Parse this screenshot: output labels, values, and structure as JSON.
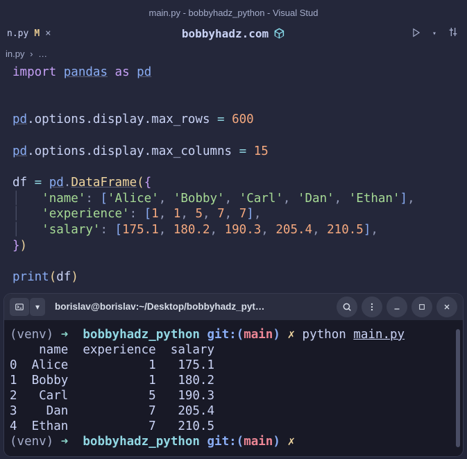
{
  "titlebar": "main.py - bobbyhadz_python - Visual Stud",
  "tab": {
    "label": "n.py",
    "modified": "M",
    "close": "×"
  },
  "center_title": "bobbyhadz.com",
  "breadcrumb": {
    "file": "in.py",
    "sep": "›",
    "more": "…"
  },
  "code": {
    "import_kw": "import",
    "pandas": "pandas",
    "as_kw": "as",
    "pd": "pd",
    "line_rows": ".options.display.max_rows ",
    "eq": "=",
    "val600": " 600",
    "line_cols": ".options.display.max_columns ",
    "val15": " 15",
    "df": "df ",
    "eq2": "= ",
    "dot": ".",
    "dataframe": "DataFrame",
    "open_p": "(",
    "open_b": "{",
    "name_key": "'name'",
    "colon": ": ",
    "names": [
      "'Alice'",
      "'Bobby'",
      "'Carl'",
      "'Dan'",
      "'Ethan'"
    ],
    "exp_key": "'experience'",
    "exps": [
      "1",
      "1",
      "5",
      "7",
      "7"
    ],
    "sal_key": "'salary'",
    "sals": [
      "175.1",
      "180.2",
      "190.3",
      "205.4",
      "210.5"
    ],
    "close_b": "}",
    "close_p": ")",
    "print": "print",
    "df_var": "df"
  },
  "terminal": {
    "path_title": "borislav@borislav:~/Desktop/bobbyhadz_pyt…",
    "venv": "(venv)",
    "arrow": "➜ ",
    "dir": "bobbyhadz_python",
    "git": "git:(",
    "branch": "main",
    "gitclose": ")",
    "x": "✗",
    "cmd_python": "python ",
    "cmd_file": "main.py",
    "out_header": "    name  experience  salary",
    "rows": [
      "0  Alice           1   175.1",
      "1  Bobby           1   180.2",
      "2   Carl           5   190.3",
      "3    Dan           7   205.4",
      "4  Ethan           7   210.5"
    ]
  }
}
